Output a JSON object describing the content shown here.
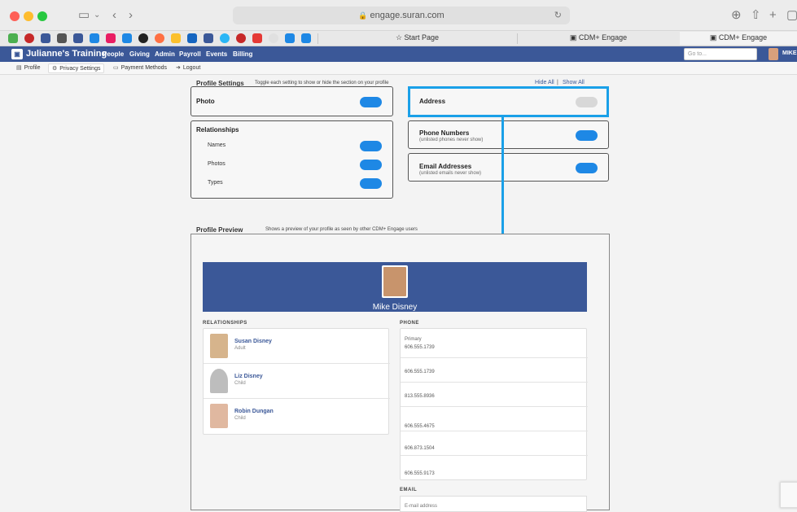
{
  "browser": {
    "url": "engage.suran.com",
    "tabs": [
      {
        "label": "Start Page"
      },
      {
        "label": "CDM+ Engage"
      },
      {
        "label": "CDM+ Engage"
      }
    ]
  },
  "app": {
    "brand": "Julianne's Training",
    "nav": [
      "People",
      "Giving",
      "Admin",
      "Payroll",
      "Events",
      "Billing"
    ],
    "goto_placeholder": "Go to...",
    "user": "MIKE"
  },
  "subnav": {
    "items": [
      {
        "label": "Profile"
      },
      {
        "label": "Privacy Settings"
      },
      {
        "label": "Payment Methods"
      },
      {
        "label": "Logout"
      }
    ]
  },
  "settings": {
    "title": "Profile Settings",
    "subtitle": "Toggle each setting to show or hide the section on your profile",
    "hide_all": "Hide All",
    "separator": "|",
    "show_all": "Show All",
    "photo": {
      "label": "Photo",
      "on": true
    },
    "relationships": {
      "label": "Relationships",
      "items": [
        {
          "label": "Names",
          "on": true
        },
        {
          "label": "Photos",
          "on": true
        },
        {
          "label": "Types",
          "on": true
        }
      ]
    },
    "address": {
      "label": "Address",
      "on": false
    },
    "phone": {
      "label": "Phone Numbers",
      "note": "(unlisted phones never show)",
      "on": true
    },
    "email": {
      "label": "Email Addresses",
      "note": "(unlisted emails never show)",
      "on": true
    }
  },
  "preview": {
    "title": "Profile Preview",
    "subtitle": "Shows a preview of your profile as seen by other CDM+ Engage users",
    "name": "Mike Disney",
    "relationships_head": "RELATIONSHIPS",
    "relationships": [
      {
        "name": "Susan Disney",
        "role": "Adult"
      },
      {
        "name": "Liz Disney",
        "role": "Child"
      },
      {
        "name": "Robin Dungan",
        "role": "Child"
      }
    ],
    "phone_head": "PHONE",
    "phones": [
      {
        "label": "Primary",
        "number": "606.555.1739"
      },
      {
        "label": "",
        "number": "606.555.1739"
      },
      {
        "label": "",
        "number": "813.555.8936"
      },
      {
        "label": "",
        "number": "606.555.4675"
      },
      {
        "label": "",
        "number": "606.873.1504"
      },
      {
        "label": "",
        "number": "606.555.9173"
      }
    ],
    "email_head": "EMAIL",
    "email_placeholder": "E-mail address"
  },
  "colors": {
    "brand": "#3b5898",
    "toggle_on": "#1e88e5",
    "highlight": "#1aa0e8"
  }
}
